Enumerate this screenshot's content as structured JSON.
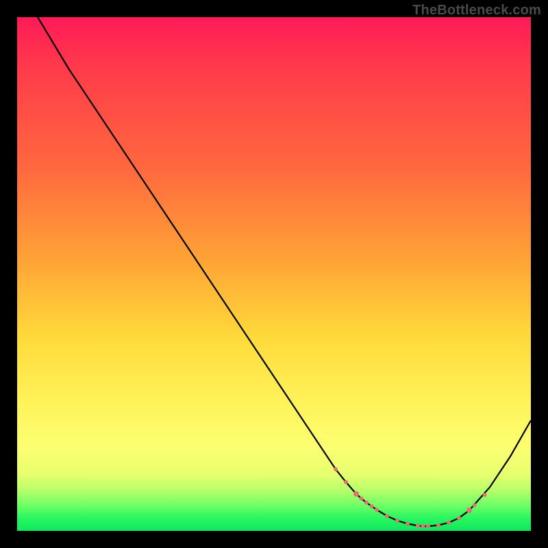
{
  "watermark": "TheBottleneck.com",
  "colors": {
    "background": "#000000",
    "curve": "#000000",
    "marker": "#e17373",
    "gradient_top": "#ff1a57",
    "gradient_bottom": "#0fe85c"
  },
  "chart_data": {
    "type": "line",
    "title": "",
    "xlabel": "",
    "ylabel": "",
    "xlim": [
      0,
      100
    ],
    "ylim": [
      0,
      100
    ],
    "x": [
      4,
      10,
      16,
      22,
      28,
      34,
      40,
      46,
      52,
      58,
      62,
      64,
      66,
      67,
      68,
      69,
      70,
      72,
      74,
      76,
      78,
      79,
      80,
      82,
      84,
      86,
      88,
      92,
      96,
      100
    ],
    "y": [
      100,
      90,
      81,
      72,
      63,
      54,
      45,
      36,
      27,
      18,
      12,
      9.5,
      7.2,
      6.3,
      5.5,
      4.8,
      4.1,
      2.9,
      2.0,
      1.4,
      1.0,
      0.9,
      0.9,
      1.1,
      1.6,
      2.5,
      4.0,
      8.5,
      14.5,
      21.5
    ],
    "series": [
      {
        "name": "bottleneck-curve",
        "x": [
          4,
          10,
          16,
          22,
          28,
          34,
          40,
          46,
          52,
          58,
          62,
          64,
          66,
          67,
          68,
          69,
          70,
          72,
          74,
          76,
          78,
          79,
          80,
          82,
          84,
          86,
          88,
          92,
          96,
          100
        ],
        "y": [
          100,
          90,
          81,
          72,
          63,
          54,
          45,
          36,
          27,
          18,
          12,
          9.5,
          7.2,
          6.3,
          5.5,
          4.8,
          4.1,
          2.9,
          2.0,
          1.4,
          1.0,
          0.9,
          0.9,
          1.1,
          1.6,
          2.5,
          4.0,
          8.5,
          14.5,
          21.5
        ]
      }
    ],
    "markers": [
      {
        "x": 62,
        "y": 12,
        "r": 3
      },
      {
        "x": 64,
        "y": 9.5,
        "r": 3
      },
      {
        "x": 66,
        "y": 7.2,
        "r": 4
      },
      {
        "x": 67,
        "y": 6.3,
        "r": 3
      },
      {
        "x": 68,
        "y": 5.5,
        "r": 3
      },
      {
        "x": 69,
        "y": 4.8,
        "r": 3
      },
      {
        "x": 70,
        "y": 4.1,
        "r": 3
      },
      {
        "x": 72,
        "y": 2.9,
        "r": 3
      },
      {
        "x": 74,
        "y": 2.0,
        "r": 3
      },
      {
        "x": 76,
        "y": 1.4,
        "r": 3
      },
      {
        "x": 78,
        "y": 1.0,
        "r": 3
      },
      {
        "x": 79,
        "y": 0.9,
        "r": 3
      },
      {
        "x": 80,
        "y": 0.9,
        "r": 3
      },
      {
        "x": 82,
        "y": 1.1,
        "r": 3
      },
      {
        "x": 84,
        "y": 1.6,
        "r": 3
      },
      {
        "x": 86,
        "y": 2.5,
        "r": 3
      },
      {
        "x": 88,
        "y": 4.0,
        "r": 4
      },
      {
        "x": 89,
        "y": 5.0,
        "r": 3
      },
      {
        "x": 91,
        "y": 7.0,
        "r": 3
      }
    ]
  }
}
